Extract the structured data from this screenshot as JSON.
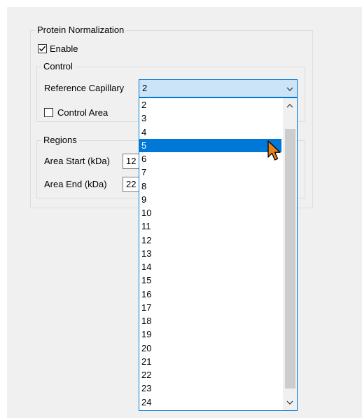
{
  "protein_normalization": {
    "title": "Protein Normalization",
    "enable_label": "Enable",
    "enable_checked": true
  },
  "control": {
    "title": "Control",
    "reference_capillary_label": "Reference Capillary",
    "reference_capillary_value": "2",
    "control_area_label": "Control Area",
    "control_area_checked": false
  },
  "regions": {
    "title": "Regions",
    "area_start_label": "Area Start (kDa)",
    "area_start_value": "12",
    "area_end_label": "Area End (kDa)",
    "area_end_value": "22"
  },
  "dropdown": {
    "options": [
      "2",
      "3",
      "4",
      "5",
      "6",
      "7",
      "8",
      "9",
      "10",
      "11",
      "12",
      "13",
      "14",
      "15",
      "16",
      "17",
      "18",
      "19",
      "20",
      "21",
      "22",
      "23",
      "24"
    ],
    "highlighted": "5"
  },
  "colors": {
    "accent": "#0078d7",
    "combo_background": "#cce4f7",
    "cursor_fill": "#e8811a"
  },
  "icons": {
    "combo_arrow": "chevron-down-icon",
    "scroll_up": "chevron-up-icon",
    "scroll_down": "chevron-down-icon",
    "pointer": "mouse-pointer-icon"
  }
}
